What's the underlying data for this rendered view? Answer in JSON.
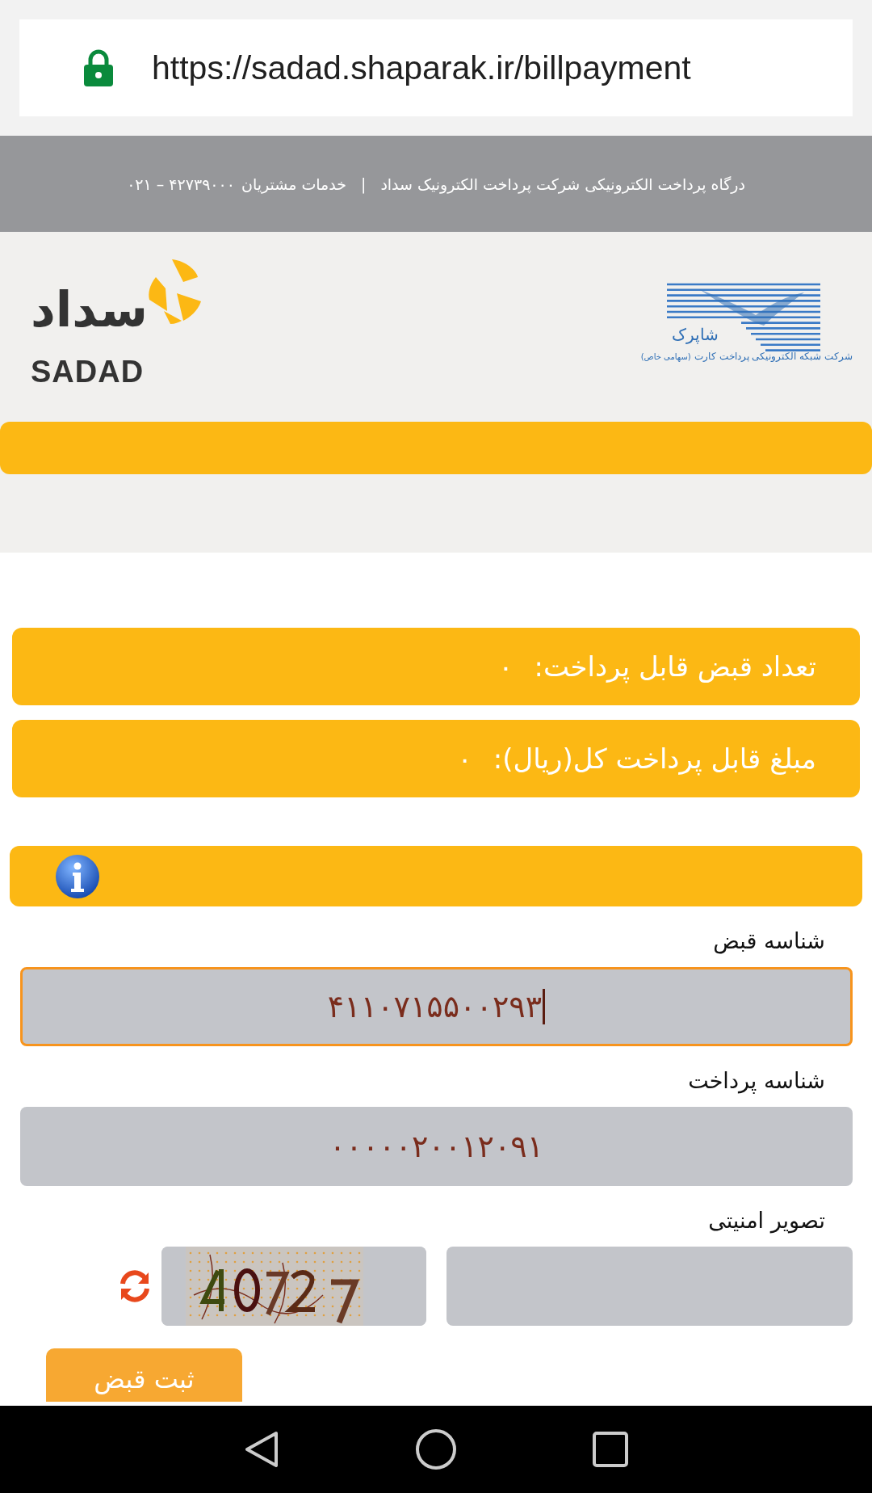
{
  "address_bar": {
    "secure": true,
    "url": "https://sadad.shaparak.ir/billpayment"
  },
  "header": {
    "title": "درگاه پرداخت الکترونیکی شرکت پرداخت الکترونیک سداد",
    "separator": "|",
    "support_label": "خدمات مشتریان",
    "support_phone": "۰۲۱ – ۴۲۷۳۹۰۰۰"
  },
  "logos": {
    "sadad": {
      "name_fa": "سداد",
      "name_en": "SADAD"
    },
    "shaparak": {
      "name": "شاپرک",
      "company": "شرکت شبکه الکترونیکی پرداخت کارت",
      "note": "(سهامی خاص)"
    }
  },
  "summary": [
    {
      "label": "تعداد قبض قابل پرداخت:",
      "value": "۰"
    },
    {
      "label": "مبلغ قابل پرداخت کل(ریال):",
      "value": "۰"
    }
  ],
  "fields": [
    {
      "kind": "text",
      "label": "شناسه قبض",
      "value": "۴۱۱۰۷۱۵۵۰۰۲۹۳",
      "focused": true
    },
    {
      "kind": "text",
      "label": "شناسه پرداخت",
      "value": "۰۰۰۰۰۲۰۰۱۲۰۹۱",
      "focused": false
    },
    {
      "kind": "captcha",
      "label": "تصویر امنیتی"
    }
  ],
  "submit_button": "ثبت قبض"
}
